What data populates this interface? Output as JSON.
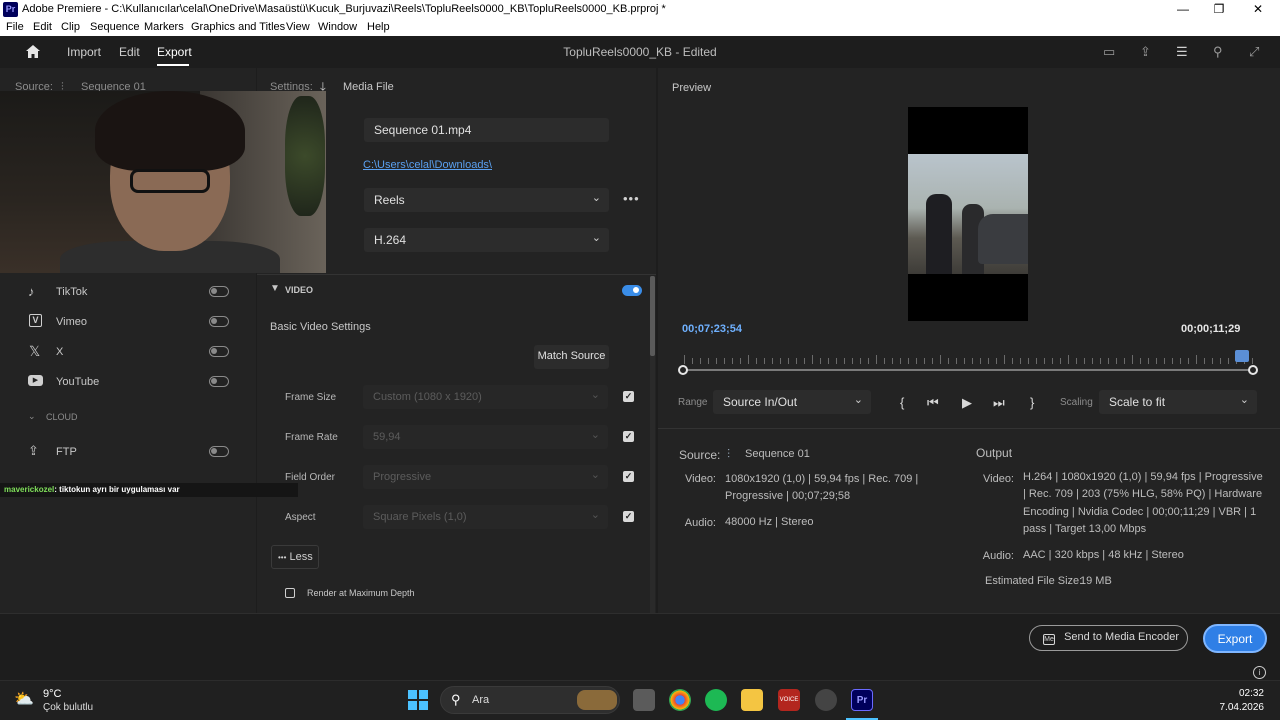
{
  "window": {
    "app_icon": "Pr",
    "title": "Adobe Premiere - C:\\Kullanıcılar\\celal\\OneDrive\\Masaüstü\\Kucuk_Burjuvazi\\Reels\\TopluReels0000_KB\\TopluReels0000_KB.prproj *",
    "controls": [
      "—",
      "❐",
      "✕"
    ]
  },
  "menu": [
    "File",
    "Edit",
    "Clip",
    "Sequence",
    "Markers",
    "Graphics and Titles",
    "View",
    "Window",
    "Help"
  ],
  "header": {
    "home_icon": "home-icon",
    "tabs": [
      "Import",
      "Edit",
      "Export"
    ],
    "active_tab": "Export",
    "project_title": "TopluReels0000_KB - Edited"
  },
  "source": {
    "label": "Source:",
    "value": "Sequence 01"
  },
  "destinations": [
    {
      "name": "TikTok",
      "icon": "tiktok-icon",
      "enabled": false
    },
    {
      "name": "Vimeo",
      "icon": "vimeo-icon",
      "enabled": false
    },
    {
      "name": "X",
      "icon": "x-icon",
      "enabled": false
    },
    {
      "name": "YouTube",
      "icon": "youtube-icon",
      "enabled": false
    }
  ],
  "cloud": {
    "section_label": "CLOUD",
    "items": [
      {
        "name": "FTP",
        "icon": "upload-icon",
        "enabled": false
      }
    ]
  },
  "chat": {
    "user": "maverickozel",
    "message": ": tiktokun ayrı bir uygulaması var"
  },
  "settings": {
    "label": "Settings:",
    "media_file_label": "Media File",
    "file_name": "Sequence 01.mp4",
    "location": "C:\\Users\\celal\\Downloads\\",
    "preset": "Reels",
    "format": "H.264",
    "more_icon": "ellipsis-icon"
  },
  "video": {
    "section_label": "VIDEO",
    "enabled": true,
    "basic_label": "Basic Video Settings",
    "match_source_label": "Match Source",
    "rows": [
      {
        "label": "Frame Size",
        "value": "Custom (1080 x 1920)",
        "checked": true
      },
      {
        "label": "Frame Rate",
        "value": "59,94",
        "checked": true
      },
      {
        "label": "Field Order",
        "value": "Progressive",
        "checked": true
      },
      {
        "label": "Aspect",
        "value": "Square Pixels (1,0)",
        "checked": true
      }
    ],
    "less_label": "Less",
    "render_max_depth_label": "Render at Maximum Depth",
    "render_max_depth_checked": false
  },
  "preview": {
    "label": "Preview",
    "time_current": "00;07;23;54",
    "time_duration": "00;00;11;29",
    "range_label": "Range",
    "range_value": "Source In/Out",
    "scaling_label": "Scaling",
    "scaling_value": "Scale to fit",
    "controls": [
      "{",
      "⏮",
      "▶",
      "⏭",
      "}"
    ]
  },
  "summary": {
    "source_label": "Source:",
    "source_value": "Sequence 01",
    "video_key": "Video:",
    "video_lines": [
      "1080x1920 (1,0)  |  59,94 fps  |  Rec. 709  |",
      "Progressive  |  00;07;29;58"
    ],
    "audio_key": "Audio:",
    "audio_value": "48000 Hz  |  Stereo",
    "output_label": "Output",
    "out_video_key": "Video:",
    "out_video_lines": [
      "H.264  |  1080x1920 (1,0)  |  59,94 fps  |  Progressive",
      "|  Rec. 709  |  203 (75% HLG, 58% PQ)  |  Hardware",
      "Encoding  |  Nvidia Codec  |  00;00;11;29  |  VBR  |  1",
      "pass  |  Target 13,00 Mbps"
    ],
    "out_audio_key": "Audio:",
    "out_audio_value": "AAC  |  320 kbps  |  48 kHz  |  Stereo",
    "file_size_label": "Estimated File Size:",
    "file_size_value": "19 MB"
  },
  "actions": {
    "send_label": "Send to Media Encoder",
    "export_label": "Export"
  },
  "taskbar": {
    "weather_temp": "9°C",
    "weather_desc": "Çok bulutlu",
    "search_label": "Ara",
    "time": "02:32",
    "date": "7.04.2026"
  },
  "colors": {
    "accent": "#3a8de8",
    "link": "#5aa0f0",
    "time_current": "#6fb1ff"
  }
}
